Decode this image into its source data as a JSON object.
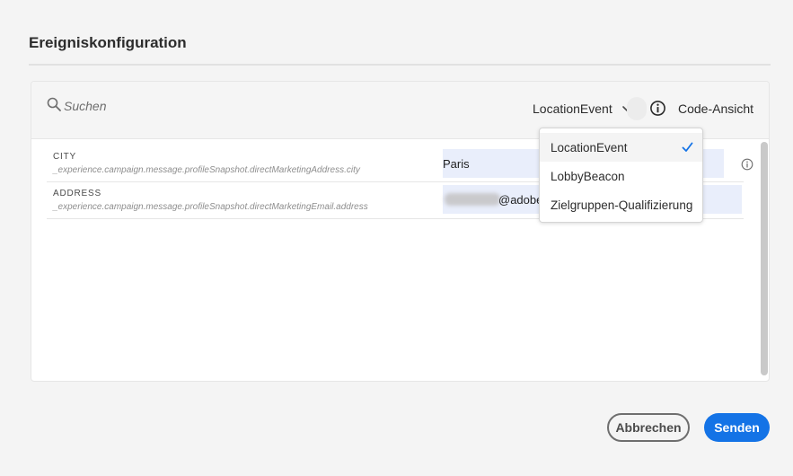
{
  "dialog": {
    "title": "Ereigniskonfiguration"
  },
  "toolbar": {
    "search_placeholder": "Suchen",
    "event_selected": "LocationEvent",
    "code_view_label": "Code-Ansicht"
  },
  "fields": [
    {
      "name": "CITY",
      "path": "_experience.campaign.message.profileSnapshot.directMarketingAddress.city",
      "value": "Paris"
    },
    {
      "name": "ADDRESS",
      "path": "_experience.campaign.message.profileSnapshot.directMarketingEmail.address",
      "value": "@adobe"
    }
  ],
  "dropdown": {
    "options": [
      "LocationEvent",
      "LobbyBeacon",
      "Zielgruppen-Qualifizierung"
    ],
    "selected": "LocationEvent"
  },
  "footer": {
    "cancel_label": "Abbrechen",
    "send_label": "Senden"
  },
  "colors": {
    "accent": "#1473e6",
    "field_background": "#e9eefb"
  }
}
